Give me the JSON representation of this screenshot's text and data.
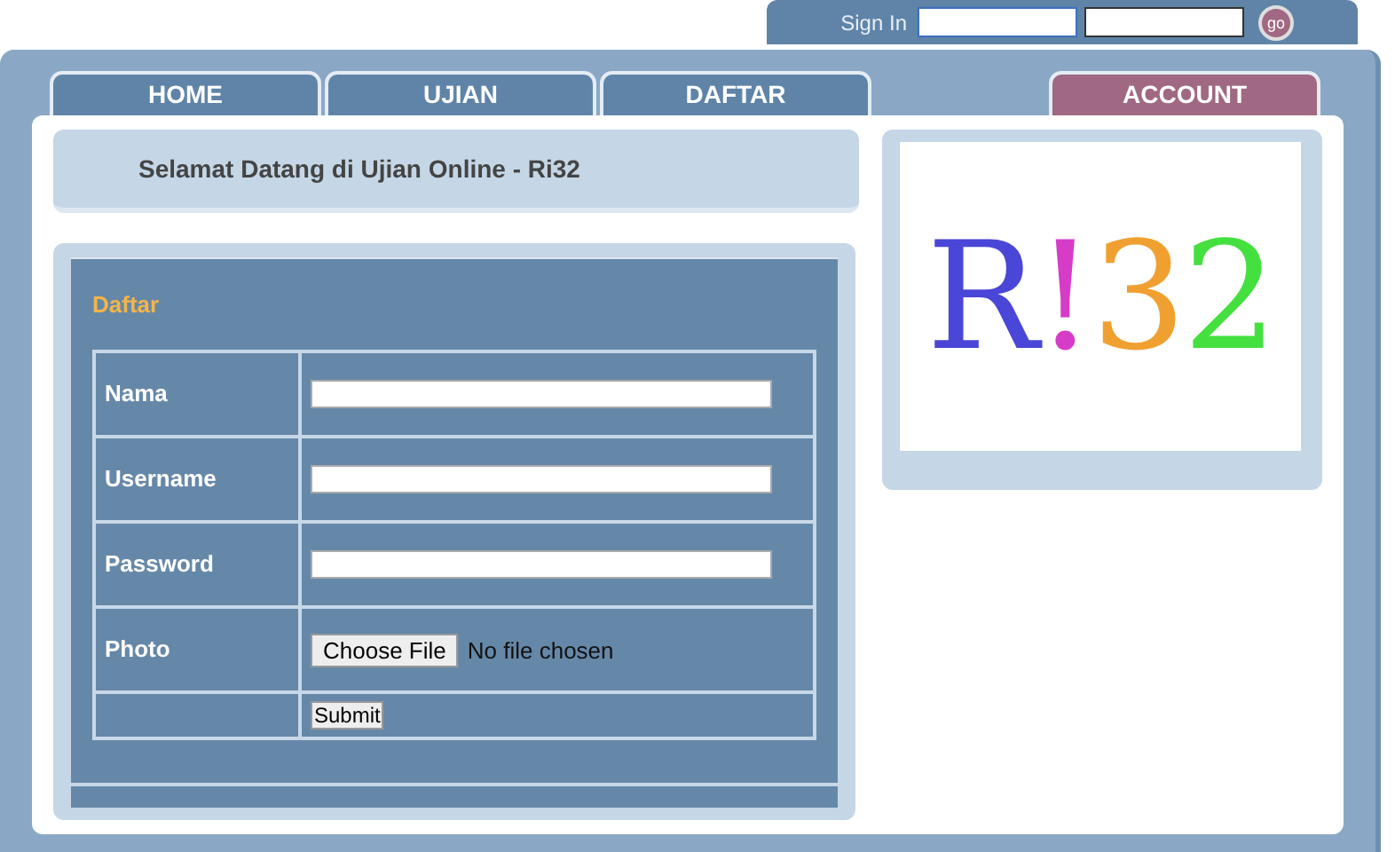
{
  "sign_in": {
    "label": "Sign In",
    "button": "go"
  },
  "tabs": [
    {
      "label": "HOME",
      "color": "#5f84a8"
    },
    {
      "label": "UJIAN",
      "color": "#5f84a8"
    },
    {
      "label": "DAFTAR",
      "color": "#5f84a8"
    },
    {
      "label": "ACCOUNT",
      "color": "#a06882"
    }
  ],
  "welcome": "Selamat Datang di Ujian Online - Ri32",
  "form": {
    "title": "Daftar",
    "rows": [
      {
        "kind": "text",
        "label": "Nama"
      },
      {
        "kind": "text",
        "label": "Username"
      },
      {
        "kind": "password",
        "label": "Password"
      },
      {
        "kind": "file",
        "label": "Photo",
        "button": "Choose File",
        "status": "No file chosen"
      },
      {
        "kind": "submit",
        "button": "Submit"
      }
    ]
  },
  "logo": "R!32"
}
